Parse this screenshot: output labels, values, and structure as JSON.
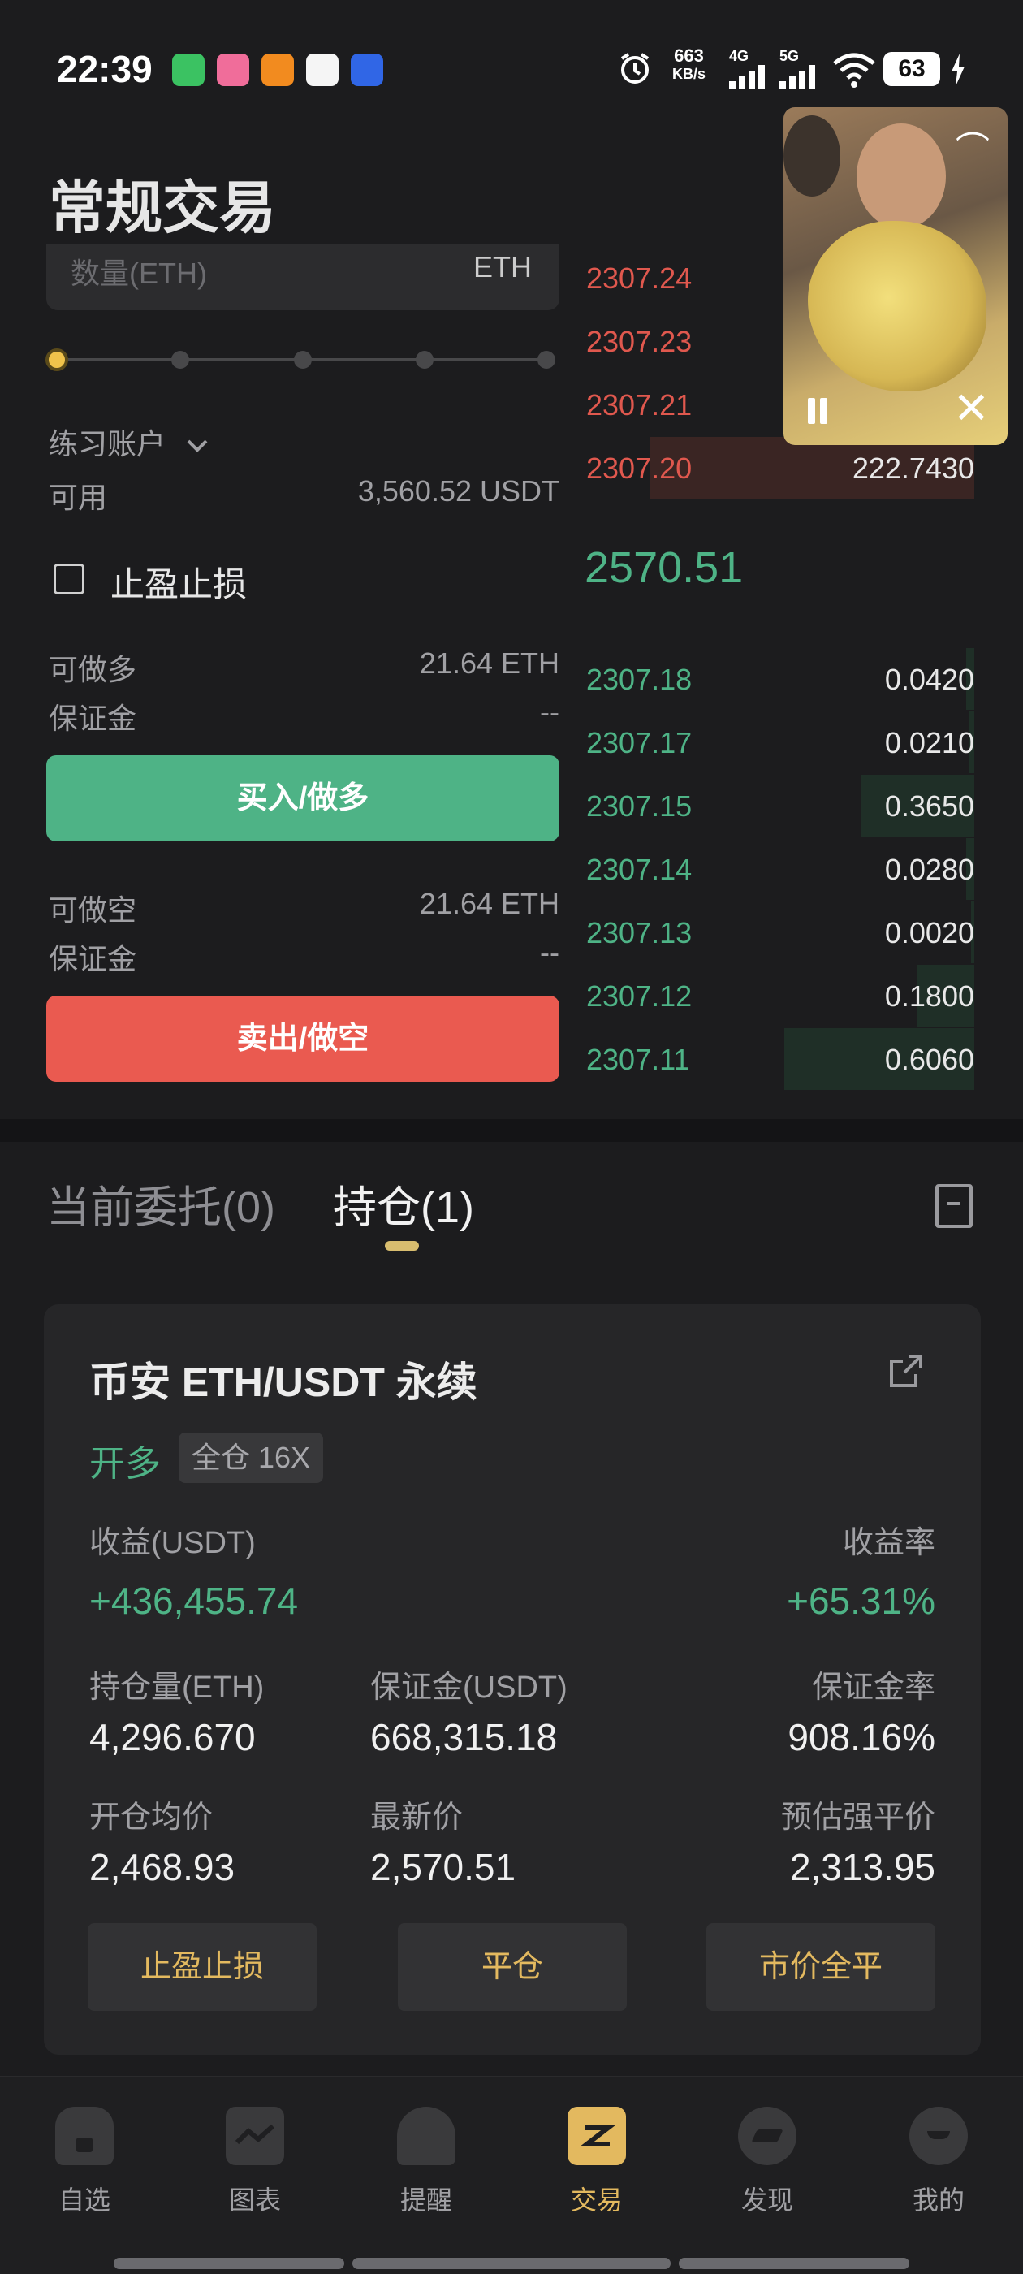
{
  "status_bar": {
    "time": "22:39",
    "net_speed_value": "663",
    "net_speed_unit": "KB/s",
    "net_4g": "4G",
    "net_5g": "5G",
    "battery": "63"
  },
  "header": {
    "title": "常规交易"
  },
  "form": {
    "qty_placeholder": "数量(ETH)",
    "qty_unit": "ETH",
    "slider_level_percent": 0,
    "account_label": "练习账户",
    "available_label": "可用",
    "available_value": "3,560.52 USDT",
    "sl_tp_label": "止盈止损",
    "long_label": "可做多",
    "long_value": "21.64 ETH",
    "margin_label": "保证金",
    "margin_value_long": "--",
    "buy_button": "买入/做多",
    "short_label": "可做空",
    "short_value": "21.64 ETH",
    "margin_value_short": "--",
    "sell_button": "卖出/做空"
  },
  "orderbook": {
    "asks": [
      {
        "price": "2307.24",
        "amount": ""
      },
      {
        "price": "2307.23",
        "amount": ""
      },
      {
        "price": "2307.21",
        "amount": ""
      },
      {
        "price": "2307.20",
        "amount": "222.7430"
      }
    ],
    "last_price": "2570.51",
    "bids": [
      {
        "price": "2307.18",
        "amount": "0.0420"
      },
      {
        "price": "2307.17",
        "amount": "0.0210"
      },
      {
        "price": "2307.15",
        "amount": "0.3650"
      },
      {
        "price": "2307.14",
        "amount": "0.0280"
      },
      {
        "price": "2307.13",
        "amount": "0.0020"
      },
      {
        "price": "2307.12",
        "amount": "0.1800"
      },
      {
        "price": "2307.11",
        "amount": "0.6060"
      }
    ]
  },
  "tabs": {
    "open_orders": "当前委托(0)",
    "positions": "持仓(1)"
  },
  "position": {
    "title": "币安 ETH/USDT 永续",
    "side": "开多",
    "mode": "全仓 16X",
    "pnl_label": "收益(USDT)",
    "pnl_value": "+436,455.74",
    "roe_label": "收益率",
    "roe_value": "+65.31%",
    "size_label": "持仓量(ETH)",
    "size_value": "4,296.670",
    "margin_label": "保证金(USDT)",
    "margin_value": "668,315.18",
    "margin_rate_label": "保证金率",
    "margin_rate_value": "908.16%",
    "entry_label": "开仓均价",
    "entry_value": "2,468.93",
    "mark_label": "最新价",
    "mark_value": "2,570.51",
    "liq_label": "预估强平价",
    "liq_value": "2,313.95",
    "btn_sltp": "止盈止损",
    "btn_close": "平仓",
    "btn_market_close": "市价全平"
  },
  "nav": {
    "items": [
      {
        "label": "自选",
        "icon": "home-icon"
      },
      {
        "label": "图表",
        "icon": "chart-icon"
      },
      {
        "label": "提醒",
        "icon": "bell-icon"
      },
      {
        "label": "交易",
        "icon": "trade-icon"
      },
      {
        "label": "发现",
        "icon": "discover-icon"
      },
      {
        "label": "我的",
        "icon": "profile-icon"
      }
    ],
    "active_index": 3
  },
  "colors": {
    "buy": "#4eb386",
    "sell": "#ea5a50",
    "accent": "#e3b95f",
    "background": "#1c1c1e"
  }
}
